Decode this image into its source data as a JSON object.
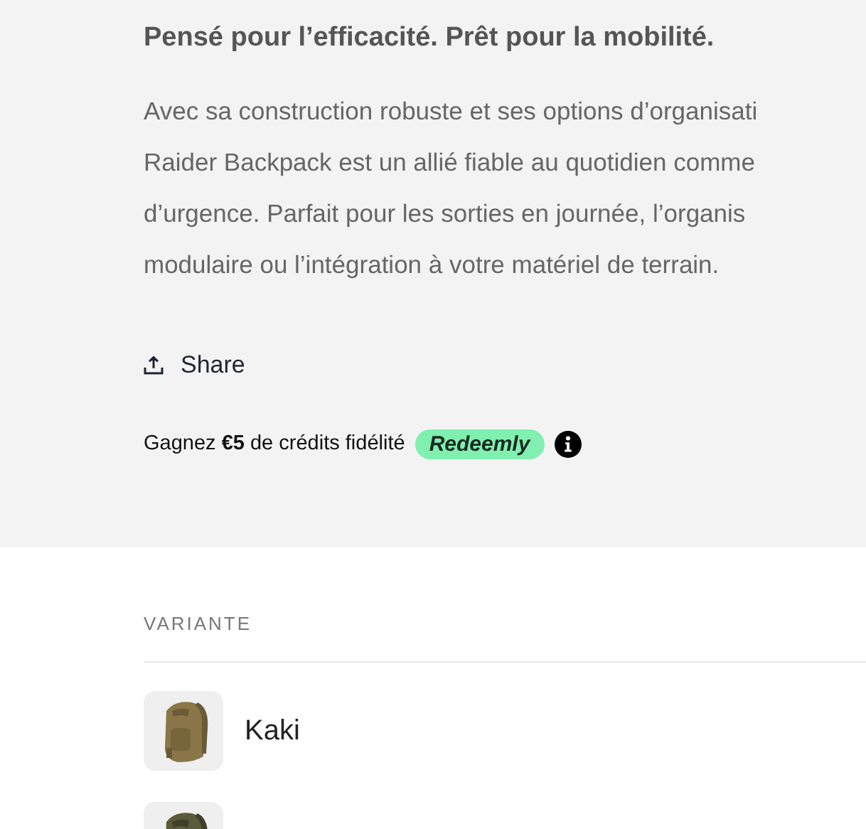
{
  "heading": "Pensé pour l’efficacité. Prêt pour la mobilité.",
  "description_lines": [
    "Avec sa construction robuste et ses options d’organisati",
    "Raider Backpack est un allié fiable au quotidien comme",
    "d’urgence. Parfait pour les sorties en journée, l’organis",
    "modulaire ou l’intégration à votre matériel de terrain."
  ],
  "share": {
    "label": "Share"
  },
  "loyalty": {
    "text": "Gagnez **€5** de crédits fidélité",
    "badge": "Redeemly"
  },
  "variant_section": {
    "title": "VARIANTE",
    "variants": [
      {
        "label": "Kaki",
        "thumbnail": {
          "kind": "picture"
        }
      },
      {
        "thumbnail": {
          "kind": "picture"
        }
      }
    ]
  }
}
